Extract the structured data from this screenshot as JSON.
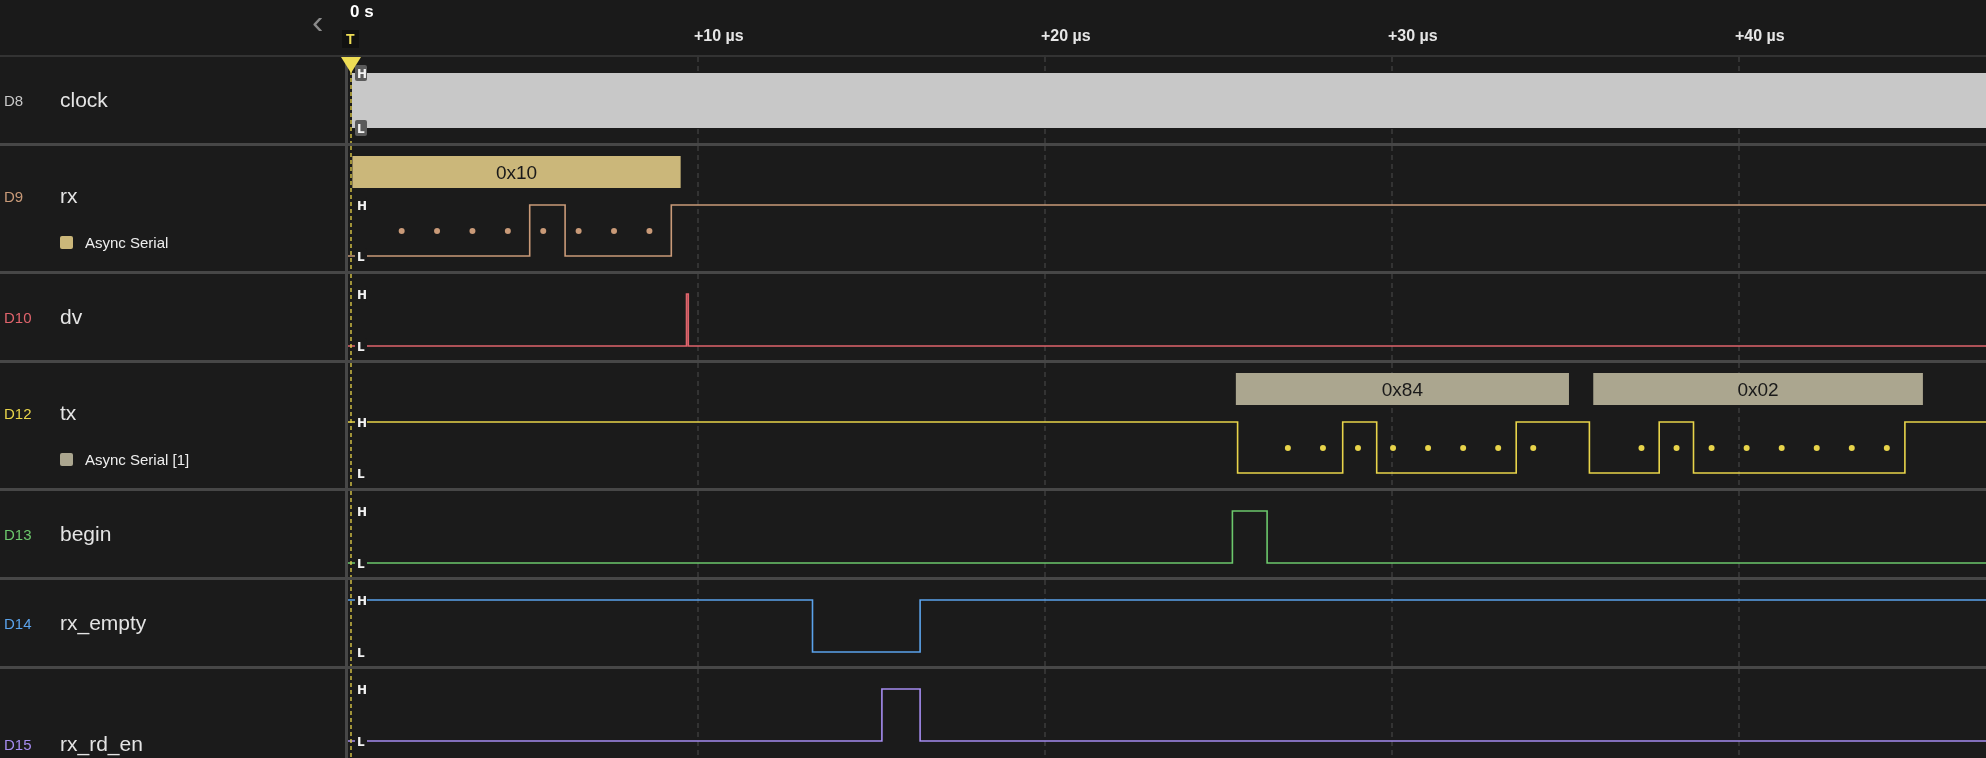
{
  "time_axis": {
    "collapse": "‹",
    "origin_label": "0 s",
    "trigger_label": "T",
    "ticks": [
      "+10 µs",
      "+20 µs",
      "+30 µs",
      "+40 µs"
    ]
  },
  "channels": [
    {
      "id": "D8",
      "name": "clock",
      "kind": "clock",
      "color": "#c8c8c8",
      "high_label": "H",
      "low_label": "L"
    },
    {
      "id": "D9",
      "name": "rx",
      "kind": "digital",
      "color": "#c99a78",
      "high_label": "H",
      "low_label": "L",
      "analyzer": {
        "name": "Async Serial",
        "color": "#cbb77a",
        "frames": [
          {
            "label": "0x10"
          }
        ]
      }
    },
    {
      "id": "D10",
      "name": "dv",
      "kind": "digital",
      "color": "#e0646c",
      "high_label": "H",
      "low_label": "L"
    },
    {
      "id": "D12",
      "name": "tx",
      "kind": "digital",
      "color": "#e8d44a",
      "high_label": "H",
      "low_label": "L",
      "analyzer": {
        "name": "Async Serial [1]",
        "color": "#aba68f",
        "frames": [
          {
            "label": "0x84"
          },
          {
            "label": "0x02"
          }
        ]
      }
    },
    {
      "id": "D13",
      "name": "begin",
      "kind": "digital",
      "color": "#6cc86c",
      "high_label": "H",
      "low_label": "L"
    },
    {
      "id": "D14",
      "name": "rx_empty",
      "kind": "digital",
      "color": "#5ba3ec",
      "high_label": "H",
      "low_label": "L"
    },
    {
      "id": "D15",
      "name": "rx_rd_en",
      "kind": "digital",
      "color": "#a58cf0",
      "high_label": "H",
      "low_label": "L"
    }
  ]
}
